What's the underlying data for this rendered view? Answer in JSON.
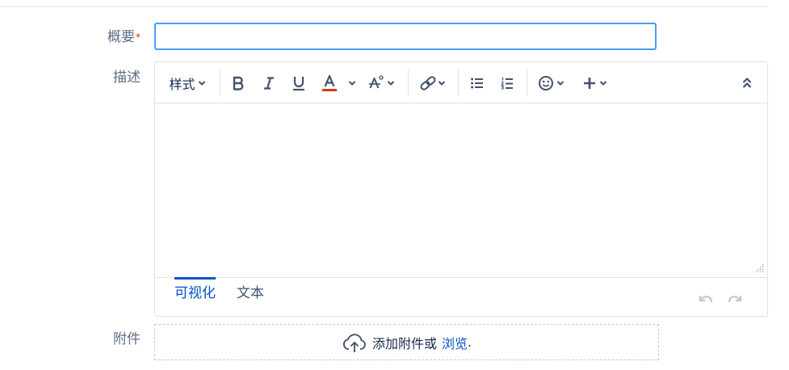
{
  "form": {
    "summary": {
      "label": "概要",
      "required_mark": "*",
      "value": ""
    },
    "description": {
      "label": "描述"
    },
    "attachment": {
      "label": "附件",
      "drop_text": "添加附件或",
      "browse_link": "浏览",
      "trailing": "."
    }
  },
  "editor": {
    "toolbar": {
      "style_label": "样式",
      "buttons": [
        {
          "name": "bold-icon"
        },
        {
          "name": "italic-icon"
        },
        {
          "name": "underline-icon"
        },
        {
          "name": "text-color-icon",
          "underline_color": "#de350b"
        },
        {
          "name": "text-effects-icon"
        },
        {
          "name": "link-icon"
        },
        {
          "name": "bullet-list-icon"
        },
        {
          "name": "numbered-list-icon"
        },
        {
          "name": "emoji-icon"
        },
        {
          "name": "insert-plus-icon"
        },
        {
          "name": "collapse-toolbar-icon"
        }
      ]
    },
    "mode_tabs": [
      {
        "label": "可视化",
        "active": true
      },
      {
        "label": "文本",
        "active": false
      }
    ]
  },
  "colors": {
    "focus_border": "#4c9aff",
    "accent": "#0052cc",
    "required": "#de350b",
    "label_text": "#5e6c84",
    "icon": "#42526e"
  }
}
